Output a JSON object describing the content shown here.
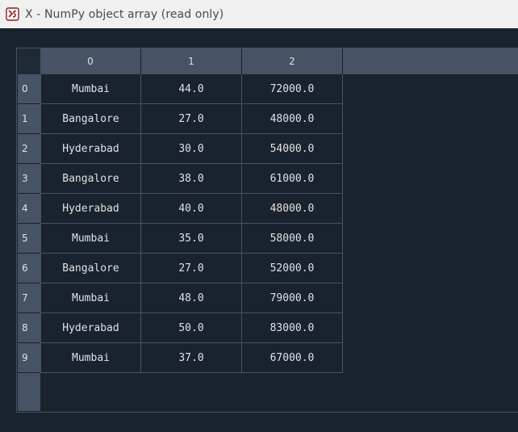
{
  "window": {
    "title": "X - NumPy object array (read only)",
    "icon": "spyder-app-icon"
  },
  "table": {
    "column_headers": [
      "0",
      "1",
      "2"
    ],
    "row_headers": [
      "0",
      "1",
      "2",
      "3",
      "4",
      "5",
      "6",
      "7",
      "8",
      "9"
    ],
    "rows": [
      [
        "Mumbai",
        "44.0",
        "72000.0"
      ],
      [
        "Bangalore",
        "27.0",
        "48000.0"
      ],
      [
        "Hyderabad",
        "30.0",
        "54000.0"
      ],
      [
        "Bangalore",
        "38.0",
        "61000.0"
      ],
      [
        "Hyderabad",
        "40.0",
        "48000.0"
      ],
      [
        "Mumbai",
        "35.0",
        "58000.0"
      ],
      [
        "Bangalore",
        "27.0",
        "52000.0"
      ],
      [
        "Mumbai",
        "48.0",
        "79000.0"
      ],
      [
        "Hyderabad",
        "50.0",
        "83000.0"
      ],
      [
        "Mumbai",
        "37.0",
        "67000.0"
      ]
    ]
  },
  "colors": {
    "background": "#19232d",
    "header": "#455364",
    "text": "#e0e1e3",
    "titlebar": "#f0f0f0"
  }
}
